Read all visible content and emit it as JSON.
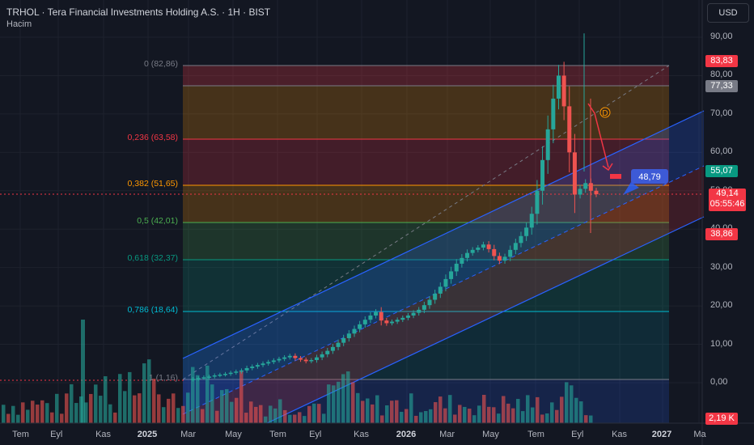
{
  "header": {
    "title": "TRHOL · Tera Financial Investments Holding A.S. · 1H · BIST",
    "volume_label": "Hacim"
  },
  "currency_button": "USD",
  "price_axis": {
    "ticks": [
      "90,00",
      "80,00",
      "70,00",
      "60,00",
      "50,00",
      "40,00",
      "30,00",
      "20,00",
      "10,00",
      "0,00"
    ],
    "badges": [
      {
        "label": "83,83",
        "color": "#f23645"
      },
      {
        "label": "77,33",
        "color": "#787b86"
      },
      {
        "label": "55,07",
        "color": "#089981"
      },
      {
        "label": "49,14",
        "sub": "05:55:46",
        "color": "#f23645"
      },
      {
        "label": "38,86",
        "color": "#f23645"
      },
      {
        "label": "2,19 K",
        "color": "#f23645"
      }
    ]
  },
  "time_axis": {
    "labels": [
      "Tem",
      "Eyl",
      "Kas",
      "2025",
      "Mar",
      "May",
      "Tem",
      "Eyl",
      "Kas",
      "2026",
      "Mar",
      "May",
      "Tem",
      "Eyl",
      "Kas",
      "2027",
      "Ma"
    ]
  },
  "fibonacci": [
    {
      "label": "0 (82,86)",
      "color": "#787b86"
    },
    {
      "label": "0,236 (63,58)",
      "color": "#f23645"
    },
    {
      "label": "0,382 (51,65)",
      "color": "#ff9800"
    },
    {
      "label": "0,5 (42,01)",
      "color": "#4caf50"
    },
    {
      "label": "0,618 (32,37)",
      "color": "#089981"
    },
    {
      "label": "0,786 (18,64)",
      "color": "#00bcd4"
    },
    {
      "label": "1 (1,16)",
      "color": "#787b86"
    }
  ],
  "annotations": {
    "target_label": "48,79",
    "marker": "D"
  },
  "colors": {
    "up": "#26a69a",
    "down": "#ef5350",
    "channel": "#2962ff",
    "background": "#131722"
  },
  "chart_data": {
    "type": "candlestick",
    "title": "TRHOL · Tera Financial Investments Holding A.S. · 1H · BIST",
    "ylim": [
      -8,
      95
    ],
    "grid": true,
    "series": [
      {
        "name": "",
        "values": [
          0.8,
          1.0,
          1.2,
          1.4,
          1.6,
          1.9,
          2.1,
          2.3,
          2.6,
          2.9,
          3.2,
          3.8,
          4.2,
          4.6,
          5.0,
          5.4,
          5.8,
          6.2,
          6.6,
          7.0,
          6.4,
          6.0,
          5.6,
          5.9,
          6.6,
          7.4,
          8.3,
          9.3,
          10.4,
          11.6,
          12.8,
          14.0,
          15.2,
          16.4,
          17.5,
          18.4,
          16.2,
          15.5,
          15.9,
          16.4,
          16.9,
          17.5,
          18.2,
          19.0,
          20.2,
          21.6,
          23.2,
          25.0,
          27.0,
          29.0,
          31.0,
          32.5,
          33.8,
          34.6,
          35.2,
          36.0,
          34.8,
          33.0,
          31.8,
          32.8,
          34.6,
          36.4,
          38.2,
          40.4,
          44.0,
          50.0,
          58.0,
          66.0,
          74.0,
          80.0,
          72.0,
          60.0,
          49.0,
          50.5,
          52.0,
          50.0,
          49.1
        ]
      }
    ]
  }
}
